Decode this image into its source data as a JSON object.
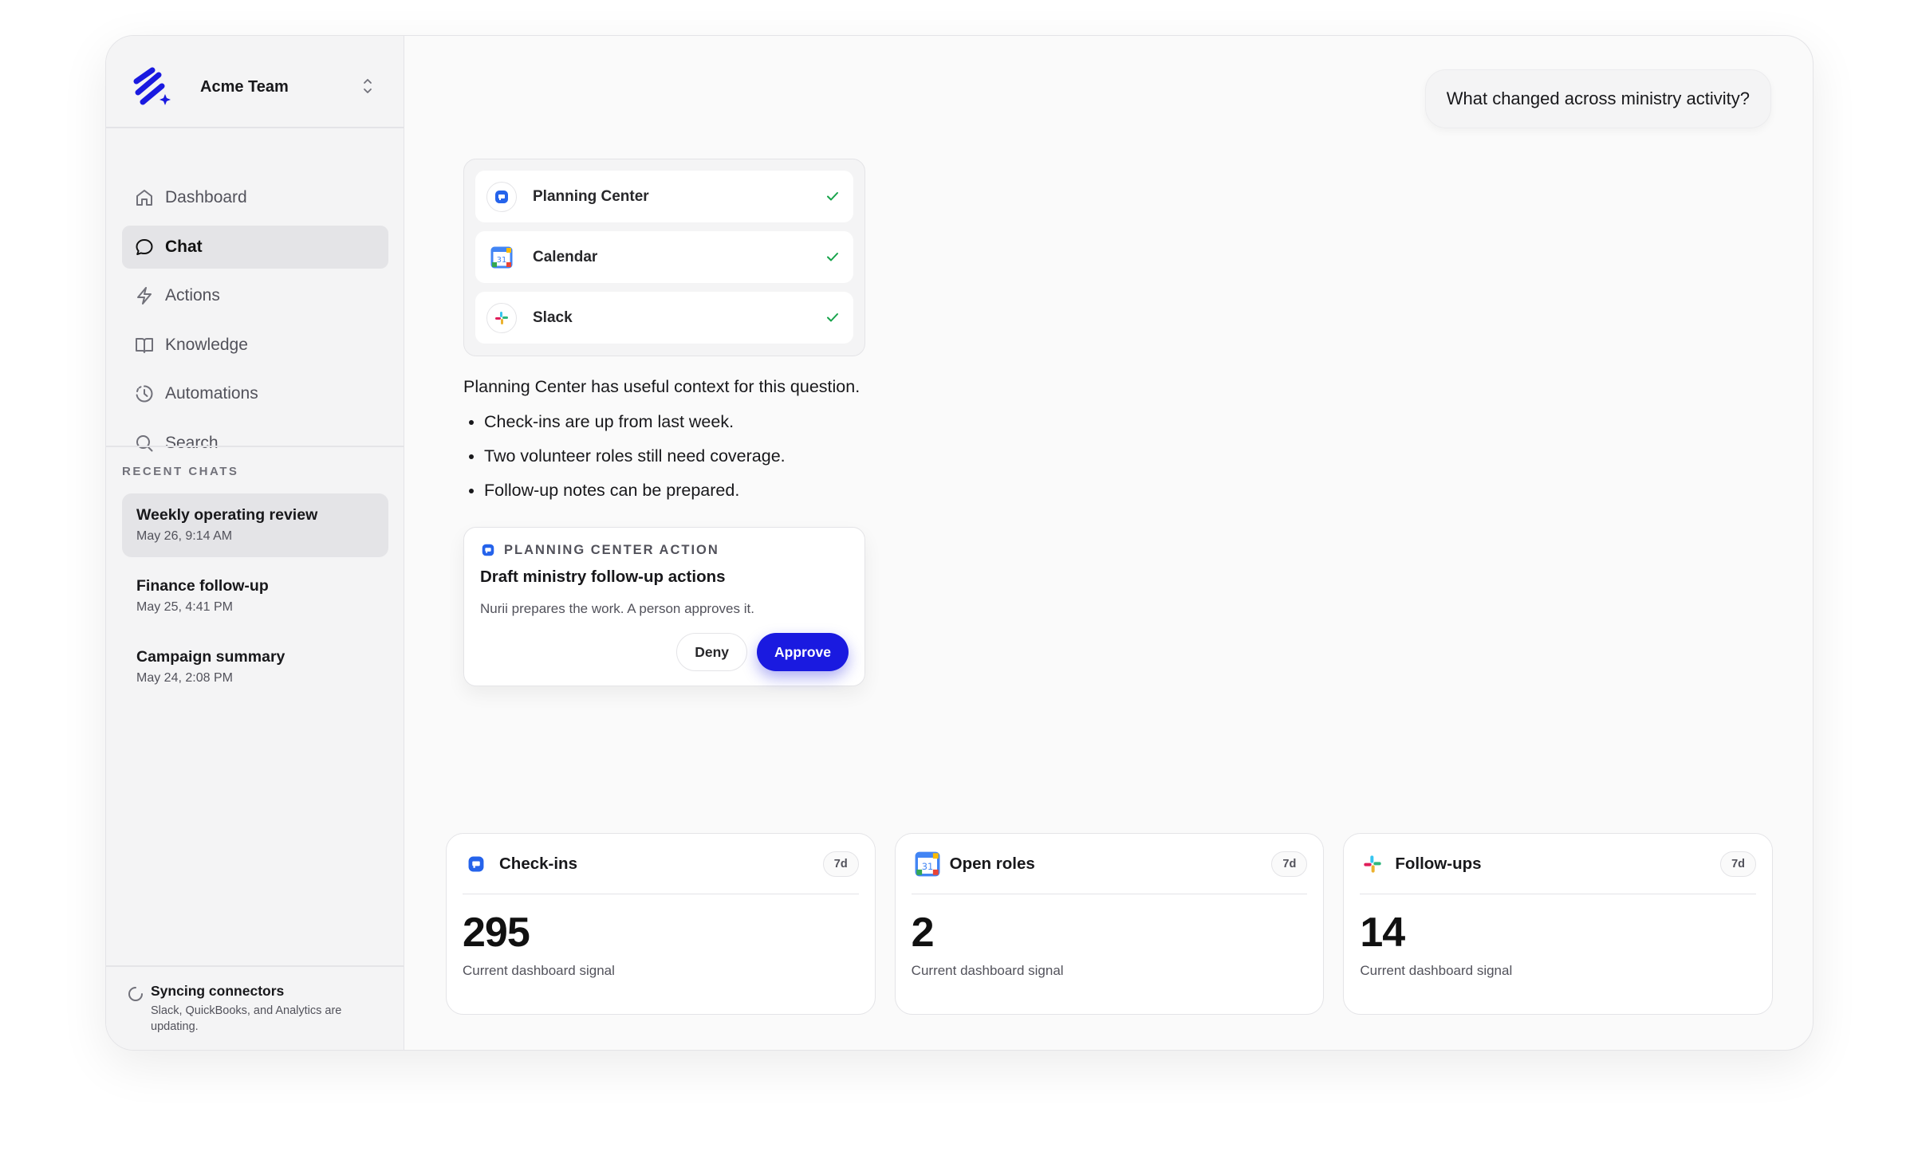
{
  "sidebar": {
    "team_name": "Acme Team",
    "nav": [
      {
        "label": "Dashboard",
        "icon": "home-icon"
      },
      {
        "label": "Chat",
        "icon": "chat-bubble-icon",
        "active": true
      },
      {
        "label": "Actions",
        "icon": "lightning-icon"
      },
      {
        "label": "Knowledge",
        "icon": "book-icon"
      },
      {
        "label": "Automations",
        "icon": "clock-icon"
      },
      {
        "label": "Search",
        "icon": "search-icon"
      }
    ],
    "recent_title": "RECENT CHATS",
    "recent": [
      {
        "title": "Weekly operating review",
        "date": "May 26, 9:14 AM",
        "active": true
      },
      {
        "title": "Finance follow-up",
        "date": "May 25, 4:41 PM"
      },
      {
        "title": "Campaign summary",
        "date": "May 24, 2:08 PM"
      }
    ],
    "sync": {
      "title": "Syncing connectors",
      "desc": "Slack, QuickBooks, and Analytics are updating."
    }
  },
  "chat": {
    "question": "What changed across ministry activity?",
    "connectors": [
      {
        "name": "Planning Center",
        "icon": "planning-center-icon"
      },
      {
        "name": "Calendar",
        "icon": "calendar-icon"
      },
      {
        "name": "Slack",
        "icon": "slack-icon"
      }
    ],
    "answer_intro": "Planning Center has useful context for this question.",
    "answer_points": [
      "Check-ins are up from last week.",
      "Two volunteer roles still need coverage.",
      "Follow-up notes can be prepared."
    ],
    "action": {
      "kicker": "PLANNING CENTER ACTION",
      "title": "Draft ministry follow-up actions",
      "desc": "Nurii prepares the work. A person approves it.",
      "deny": "Deny",
      "approve": "Approve"
    }
  },
  "metrics": [
    {
      "name": "Check-ins",
      "badge": "7d",
      "value": "295",
      "sub": "Current dashboard signal",
      "icon": "planning-center-icon"
    },
    {
      "name": "Open roles",
      "badge": "7d",
      "value": "2",
      "sub": "Current dashboard signal",
      "icon": "calendar-icon"
    },
    {
      "name": "Follow-ups",
      "badge": "7d",
      "value": "14",
      "sub": "Current dashboard signal",
      "icon": "slack-icon"
    }
  ],
  "colors": {
    "accent": "#1a1ae0",
    "check": "#16a34a",
    "pc_blue": "#2563eb"
  }
}
